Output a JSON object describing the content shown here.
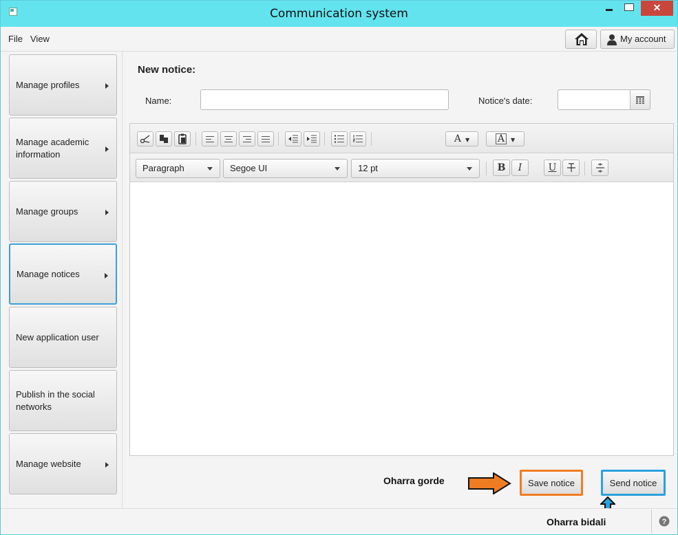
{
  "window": {
    "title": "Communication system",
    "close_glyph": "✕"
  },
  "menu": {
    "file": "File",
    "view": "View"
  },
  "account": {
    "label": "My account"
  },
  "sidebar": {
    "items": [
      {
        "label": "Manage profiles"
      },
      {
        "label": "Manage academic information"
      },
      {
        "label": "Manage groups"
      },
      {
        "label": "Manage notices"
      },
      {
        "label": "New application user"
      },
      {
        "label": "Publish in the social networks"
      },
      {
        "label": "Manage website"
      }
    ],
    "active_item": "Manage notices"
  },
  "form": {
    "heading": "New notice:",
    "name_label": "Name:",
    "name_value": "",
    "date_label": "Notice's date:",
    "date_value": ""
  },
  "editor": {
    "paragraph_style": "Paragraph",
    "font_family": "Segoe UI",
    "font_size": "12 pt",
    "bold": "B",
    "italic": "I",
    "underline": "U",
    "font_color_glyph": "A",
    "background_color_glyph": "A",
    "content": ""
  },
  "actions": {
    "save": "Save notice",
    "send": "Send notice"
  },
  "annotations": {
    "save": "Oharra gorde",
    "send": "Oharra bidali",
    "save_color": "#f07c22",
    "send_color": "#2aa1dc"
  },
  "icons": [
    "app-icon",
    "minimize-icon",
    "maximize-icon",
    "close-icon",
    "home-icon",
    "user-icon",
    "calendar-icon",
    "cut-icon",
    "copy-icon",
    "paste-icon",
    "align-left-icon",
    "align-center-icon",
    "align-right-icon",
    "justify-icon",
    "outdent-icon",
    "indent-icon",
    "bullet-list-icon",
    "numbered-list-icon",
    "font-color-icon",
    "background-color-icon",
    "strikethrough-icon",
    "horizontal-rule-icon",
    "help-icon",
    "arrow-right-icon",
    "arrow-up-icon"
  ]
}
